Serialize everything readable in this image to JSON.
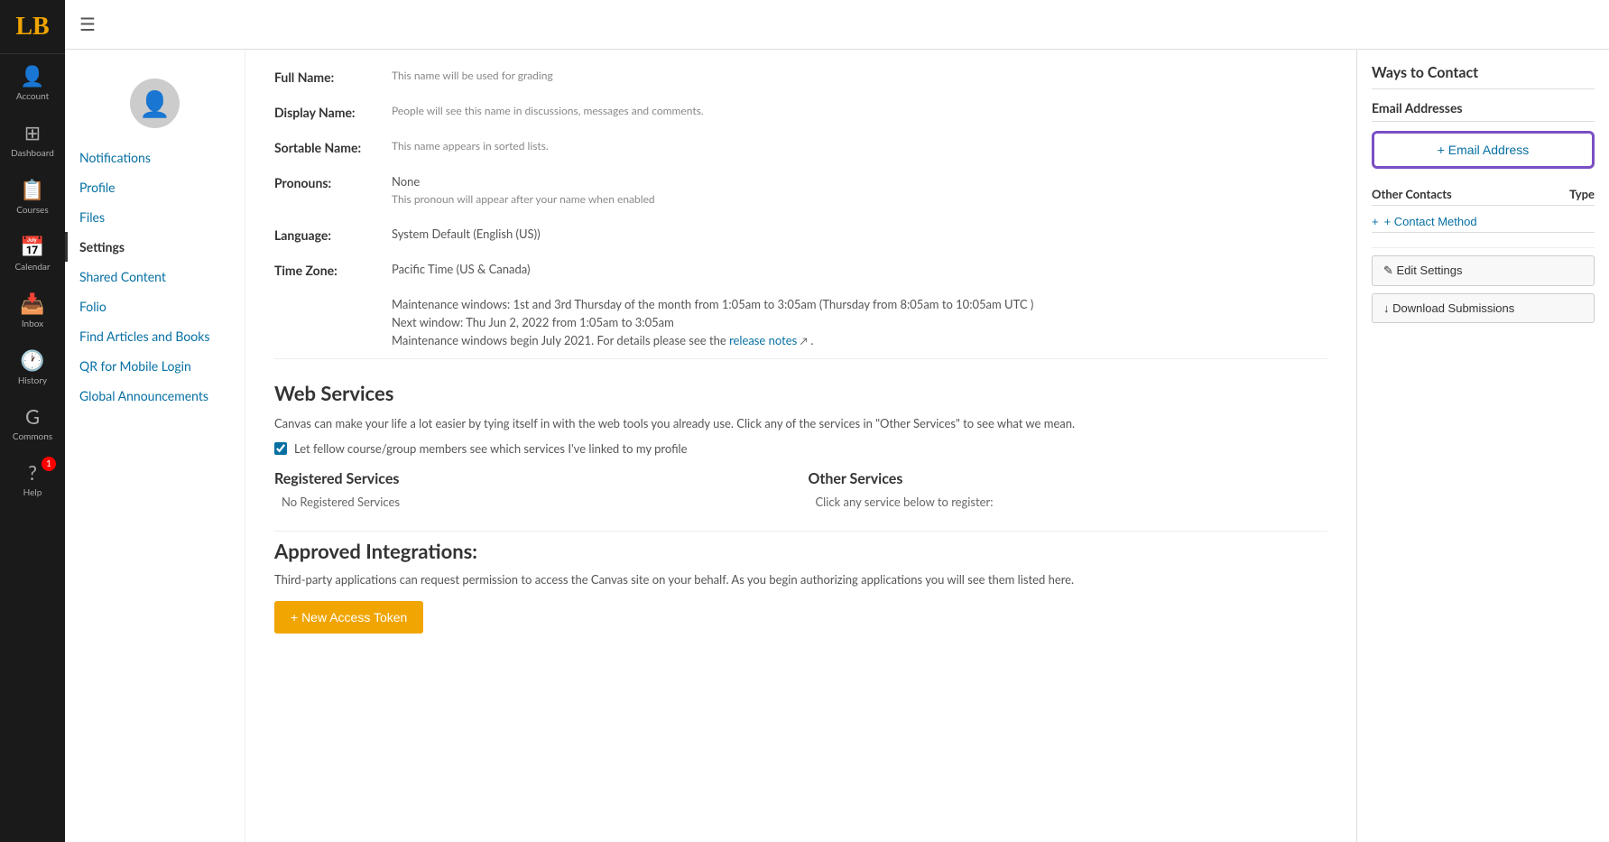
{
  "logo": "LB",
  "topbar": {
    "hamburger": "☰"
  },
  "sidebar_nav": [
    {
      "id": "account",
      "icon": "👤",
      "label": "Account"
    },
    {
      "id": "dashboard",
      "icon": "⊞",
      "label": "Dashboard"
    },
    {
      "id": "courses",
      "icon": "📋",
      "label": "Courses"
    },
    {
      "id": "calendar",
      "icon": "📅",
      "label": "Calendar"
    },
    {
      "id": "inbox",
      "icon": "📥",
      "label": "Inbox"
    },
    {
      "id": "history",
      "icon": "🕐",
      "label": "History"
    },
    {
      "id": "commons",
      "icon": "G",
      "label": "Commons"
    },
    {
      "id": "help",
      "icon": "?",
      "label": "Help",
      "badge": "1"
    }
  ],
  "secondary_nav": [
    {
      "id": "notifications",
      "label": "Notifications",
      "active": false
    },
    {
      "id": "profile",
      "label": "Profile",
      "active": false
    },
    {
      "id": "files",
      "label": "Files",
      "active": false
    },
    {
      "id": "settings",
      "label": "Settings",
      "active": true
    },
    {
      "id": "shared-content",
      "label": "Shared Content",
      "active": false
    },
    {
      "id": "folio",
      "label": "Folio",
      "active": false
    },
    {
      "id": "find-articles",
      "label": "Find Articles and Books",
      "active": false
    },
    {
      "id": "qr-login",
      "label": "QR for Mobile Login",
      "active": false
    },
    {
      "id": "global-announcements",
      "label": "Global Announcements",
      "active": false
    }
  ],
  "profile": {
    "fields": [
      {
        "id": "full-name",
        "label": "Full Name:",
        "value": "",
        "hint": "This name will be used for grading"
      },
      {
        "id": "display-name",
        "label": "Display Name:",
        "value": "",
        "hint": "People will see this name in discussions, messages and comments."
      },
      {
        "id": "sortable-name",
        "label": "Sortable Name:",
        "value": "",
        "hint": "This name appears in sorted lists."
      },
      {
        "id": "pronouns",
        "label": "Pronouns:",
        "value": "None",
        "hint": "This pronoun will appear after your name when enabled"
      },
      {
        "id": "language",
        "label": "Language:",
        "value": "System Default (English (US))",
        "hint": ""
      },
      {
        "id": "timezone",
        "label": "Time Zone:",
        "value": "Pacific Time (US & Canada)",
        "hint": ""
      }
    ],
    "maintenance_text": "Maintenance windows: 1st and 3rd Thursday of the month from 1:05am to 3:05am (Thursday from 8:05am to 10:05am UTC )",
    "next_window_text": "Next window: Thu Jun 2, 2022 from 1:05am to 3:05am",
    "release_notes_prefix": "Maintenance windows begin July 2021. For details please see the ",
    "release_notes_link": "release notes",
    "release_notes_suffix": " ."
  },
  "web_services": {
    "title": "Web Services",
    "description": "Canvas can make your life a lot easier by tying itself in with the web tools you already use. Click any of the services in \"Other Services\" to see what we mean.",
    "checkbox_label": "Let fellow course/group members see which services I've linked to my profile",
    "registered_title": "Registered Services",
    "registered_empty": "No Registered Services",
    "other_title": "Other Services",
    "other_desc": "Click any service below to register:"
  },
  "integrations": {
    "title": "Approved Integrations:",
    "description": "Third-party applications can request permission to access the Canvas site on your behalf. As you begin authorizing applications you will see them listed here.",
    "new_token_btn": "+ New Access Token"
  },
  "right_panel": {
    "title": "Ways to Contact",
    "email_section_title": "Email Addresses",
    "add_email_btn": "+ Email Address",
    "contacts_header_left": "Other Contacts",
    "contacts_header_right": "Type",
    "add_contact_btn": "+ Contact Method",
    "edit_settings_btn": "✎ Edit Settings",
    "download_btn": "↓ Download Submissions"
  }
}
